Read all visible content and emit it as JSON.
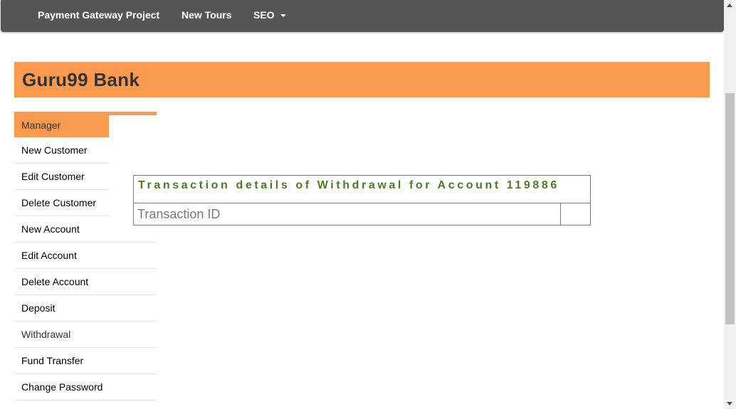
{
  "nav": {
    "items": [
      {
        "label": "Payment Gateway Project"
      },
      {
        "label": "New Tours"
      },
      {
        "label": "SEO",
        "has_dropdown": true
      }
    ],
    "background": "#555555"
  },
  "header": {
    "title": "Guru99 Bank",
    "background": "#f99a4f"
  },
  "menu": {
    "items": [
      {
        "label": "Manager",
        "active": true
      },
      {
        "label": "New Customer"
      },
      {
        "label": "Edit Customer"
      },
      {
        "label": "Delete Customer"
      },
      {
        "label": "New Account"
      },
      {
        "label": "Edit Account"
      },
      {
        "label": "Delete Account"
      },
      {
        "label": "Deposit"
      },
      {
        "label": "Withdrawal"
      },
      {
        "label": "Fund Transfer"
      },
      {
        "label": "Change Password"
      }
    ],
    "accent": "#f99a4f"
  },
  "transaction": {
    "heading": "Transaction details of Withdrawal for Account 119886",
    "heading_color": "#4d7a24",
    "rows": [
      {
        "label": "Transaction ID",
        "value": ""
      }
    ]
  }
}
